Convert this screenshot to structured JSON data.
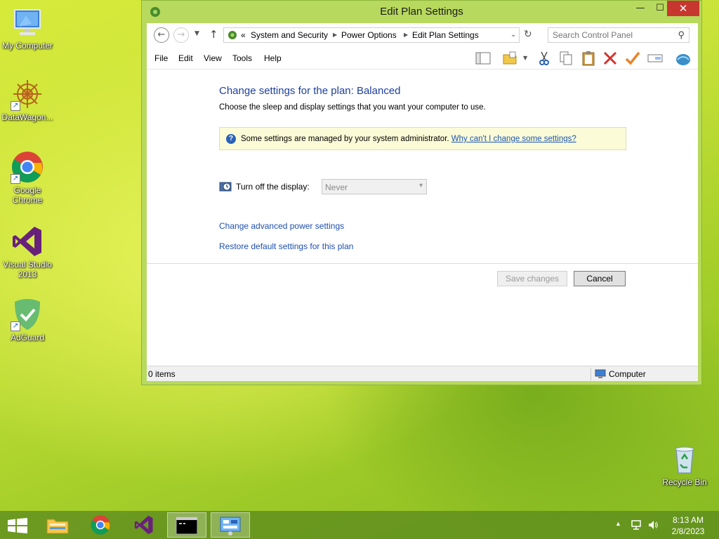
{
  "desktop": {
    "icons": [
      {
        "label": "My Computer",
        "icon": "computer-icon"
      },
      {
        "label": "DataWagon...",
        "icon": "datawagon-icon"
      },
      {
        "label": "Google Chrome",
        "icon": "chrome-icon"
      },
      {
        "label": "Visual Studio 2013",
        "icon": "visual-studio-icon"
      },
      {
        "label": "AdGuard",
        "icon": "adguard-icon"
      },
      {
        "label": "Recycle Bin",
        "icon": "recycle-bin-icon"
      }
    ]
  },
  "window": {
    "title": "Edit Plan Settings",
    "controls": {
      "minimize": "—",
      "maximize": "☐",
      "close": "✕"
    },
    "address": {
      "prefix": "«",
      "crumbs": [
        "System and Security",
        "Power Options",
        "Edit Plan Settings"
      ]
    },
    "search": {
      "placeholder": "Search Control Panel"
    },
    "menu": [
      "File",
      "Edit",
      "View",
      "Tools",
      "Help"
    ],
    "content": {
      "heading": "Change settings for the plan: Balanced",
      "subtitle": "Choose the sleep and display settings that you want your computer to use.",
      "info_message": "Some settings are managed by your system administrator.",
      "info_link": "Why can't I change some settings?",
      "display_label": "Turn off the display:",
      "display_value": "Never",
      "advanced_link": "Change advanced power settings",
      "restore_link": "Restore default settings for this plan",
      "save_label": "Save changes",
      "cancel_label": "Cancel"
    },
    "status": {
      "items": "0 items",
      "location": "Computer"
    }
  },
  "taskbar": {
    "apps": [
      {
        "name": "File Explorer",
        "icon": "file-explorer-icon"
      },
      {
        "name": "Google Chrome",
        "icon": "chrome-icon"
      },
      {
        "name": "Visual Studio",
        "icon": "visual-studio-icon"
      },
      {
        "name": "Command Prompt",
        "icon": "cmd-icon",
        "active": true
      },
      {
        "name": "Control Panel",
        "icon": "control-panel-icon",
        "active": true
      }
    ],
    "time": "8:13 AM",
    "date": "2/8/2023"
  },
  "colors": {
    "accent": "#1e3f9c",
    "link": "#1a56b5",
    "close_button": "#c7372f",
    "window_frame": "#b7d95d"
  }
}
